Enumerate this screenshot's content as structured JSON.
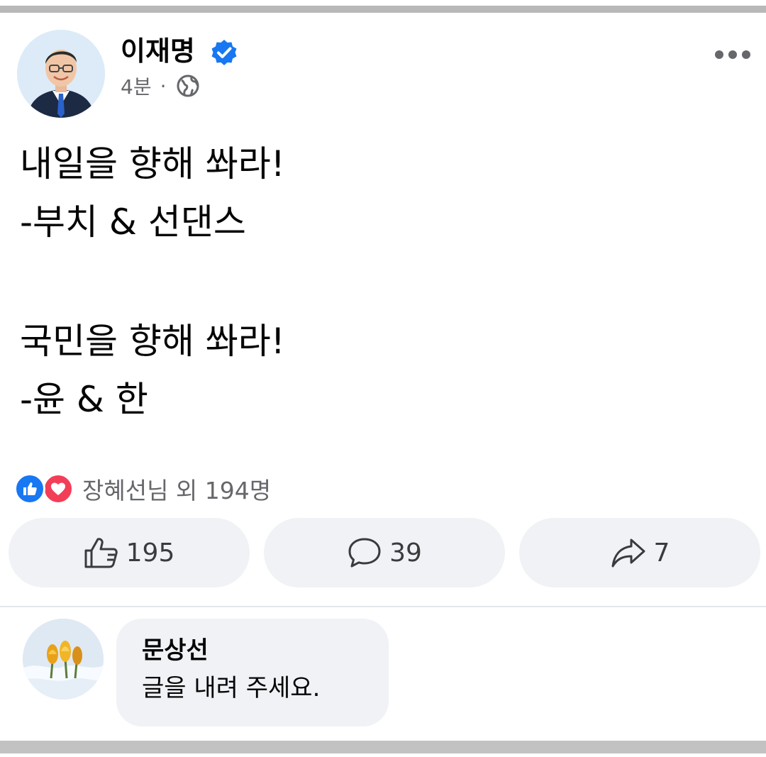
{
  "post": {
    "author": "이재명",
    "verified": true,
    "time": "4분",
    "separator": "·",
    "privacy_icon": "globe-icon",
    "more_icon": "more-horizontal-icon",
    "text_lines": {
      "l1": "내일을 향해 쏴라!",
      "l2": "-부치 & 선댄스",
      "l3": "국민을 향해 쏴라!",
      "l4": "-윤 & 한"
    }
  },
  "reactions": {
    "icons": [
      "like-icon",
      "love-icon"
    ],
    "summary": "장혜선님 외 194명"
  },
  "actions": {
    "like": {
      "icon": "thumbs-up-icon",
      "count": "195"
    },
    "comment": {
      "icon": "comment-icon",
      "count": "39"
    },
    "share": {
      "icon": "share-icon",
      "count": "7"
    }
  },
  "comment": {
    "author": "문상선",
    "text": "글을 내려 주세요."
  },
  "colors": {
    "verified_blue": "#1877f2",
    "like_blue": "#1877f2",
    "love_red": "#f33e58",
    "secondary_text": "#65676b",
    "button_bg": "#f0f2f5"
  }
}
